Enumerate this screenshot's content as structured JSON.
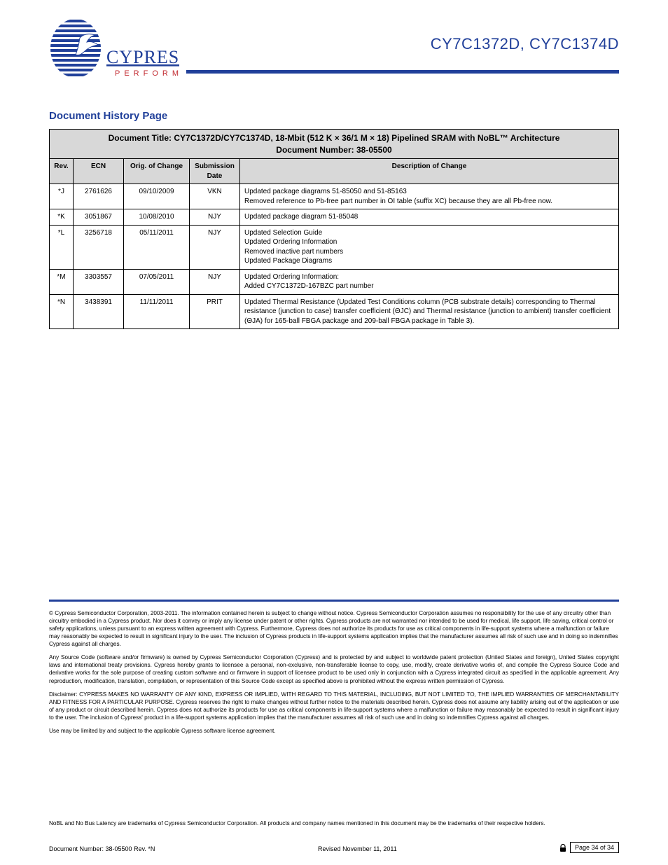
{
  "header": {
    "part_number": "CY7C1372D, CY7C1374D",
    "logo_top": "CYPRESS",
    "logo_sub": "P E R F O R M"
  },
  "revision_history": {
    "title": "Document History Page",
    "table_title": "Document Title: CY7C1372D/CY7C1374D, 18-Mbit (512 K × 36/1 M × 18) Pipelined SRAM with NoBL™ Architecture\nDocument Number: 38-05500",
    "columns": [
      "Rev.",
      "ECN",
      "Orig. of Change",
      "Submission Date",
      "Description of Change"
    ],
    "rows": [
      {
        "rev": "*J",
        "ecn": "2761626",
        "date": "09/10/2009",
        "orig": "VKN",
        "desc": "Updated package diagrams 51-85050 and 51-85163\nRemoved reference to Pb-free part number in OI table (suffix XC) because they are all Pb-free now."
      },
      {
        "rev": "*K",
        "ecn": "3051867",
        "date": "10/08/2010",
        "orig": "NJY",
        "desc": "Updated package diagram 51-85048"
      },
      {
        "rev": "*L",
        "ecn": "3256718",
        "date": "05/11/2011",
        "orig": "NJY",
        "desc": "Updated Selection Guide\nUpdated Ordering Information\nRemoved inactive part numbers\nUpdated Package Diagrams"
      },
      {
        "rev": "*M",
        "ecn": "3303557",
        "date": "07/05/2011",
        "orig": "NJY",
        "desc": "Updated Ordering Information:\nAdded CY7C1372D-167BZC part number"
      },
      {
        "rev": "*N",
        "ecn": "3438391",
        "date": "11/11/2011",
        "orig": "PRIT",
        "desc": "Updated Thermal Resistance (Updated Test Conditions column (PCB substrate details) corresponding to Thermal resistance (junction to case) transfer coefficient (ΘJC) and Thermal resistance (junction to ambient) transfer coefficient (ΘJA) for 165-ball FBGA package and 209-ball FBGA package in Table 3)."
      }
    ]
  },
  "disclaimer": {
    "copyright": "© Cypress Semiconductor Corporation, 2003-2011. The information contained herein is subject to change without notice. Cypress Semiconductor Corporation assumes no responsibility for the use of any circuitry other than circuitry embodied in a Cypress product. Nor does it convey or imply any license under patent or other rights. Cypress products are not warranted nor intended to be used for medical, life support, life saving, critical control or safety applications, unless pursuant to an express written agreement with Cypress. Furthermore, Cypress does not authorize its products for use as critical components in life-support systems where a malfunction or failure may reasonably be expected to result in significant injury to the user. The inclusion of Cypress products in life-support systems application implies that the manufacturer assumes all risk of such use and in doing so indemnifies Cypress against all charges.",
    "ip": "Any Source Code (software and/or firmware) is owned by Cypress Semiconductor Corporation (Cypress) and is protected by and subject to worldwide patent protection (United States and foreign), United States copyright laws and international treaty provisions. Cypress hereby grants to licensee a personal, non-exclusive, non-transferable license to copy, use, modify, create derivative works of, and compile the Cypress Source Code and derivative works for the sole purpose of creating custom software and or firmware in support of licensee product to be used only in conjunction with a Cypress integrated circuit as specified in the applicable agreement. Any reproduction, modification, translation, compilation, or representation of this Source Code except as specified above is prohibited without the express written permission of Cypress.",
    "warranty": "Disclaimer: CYPRESS MAKES NO WARRANTY OF ANY KIND, EXPRESS OR IMPLIED, WITH REGARD TO THIS MATERIAL, INCLUDING, BUT NOT LIMITED TO, THE IMPLIED WARRANTIES OF MERCHANTABILITY AND FITNESS FOR A PARTICULAR PURPOSE. Cypress reserves the right to make changes without further notice to the materials described herein. Cypress does not assume any liability arising out of the application or use of any product or circuit described herein. Cypress does not authorize its products for use as critical components in life-support systems where a malfunction or failure may reasonably be expected to result in significant injury to the user. The inclusion of Cypress' product in a life-support systems application implies that the manufacturer assumes all risk of such use and in doing so indemnifies Cypress against all charges.",
    "rights": "Use may be limited by and subject to the applicable Cypress software license agreement."
  },
  "footer": {
    "doc_num": "Document Number: 38-05500 Rev. *N",
    "revised": "Revised November 11, 2011",
    "page": "Page 34 of 34",
    "trademark": "NoBL and No Bus Latency are trademarks of Cypress Semiconductor Corporation. All products and company names mentioned in this document may be the trademarks of their respective holders."
  }
}
